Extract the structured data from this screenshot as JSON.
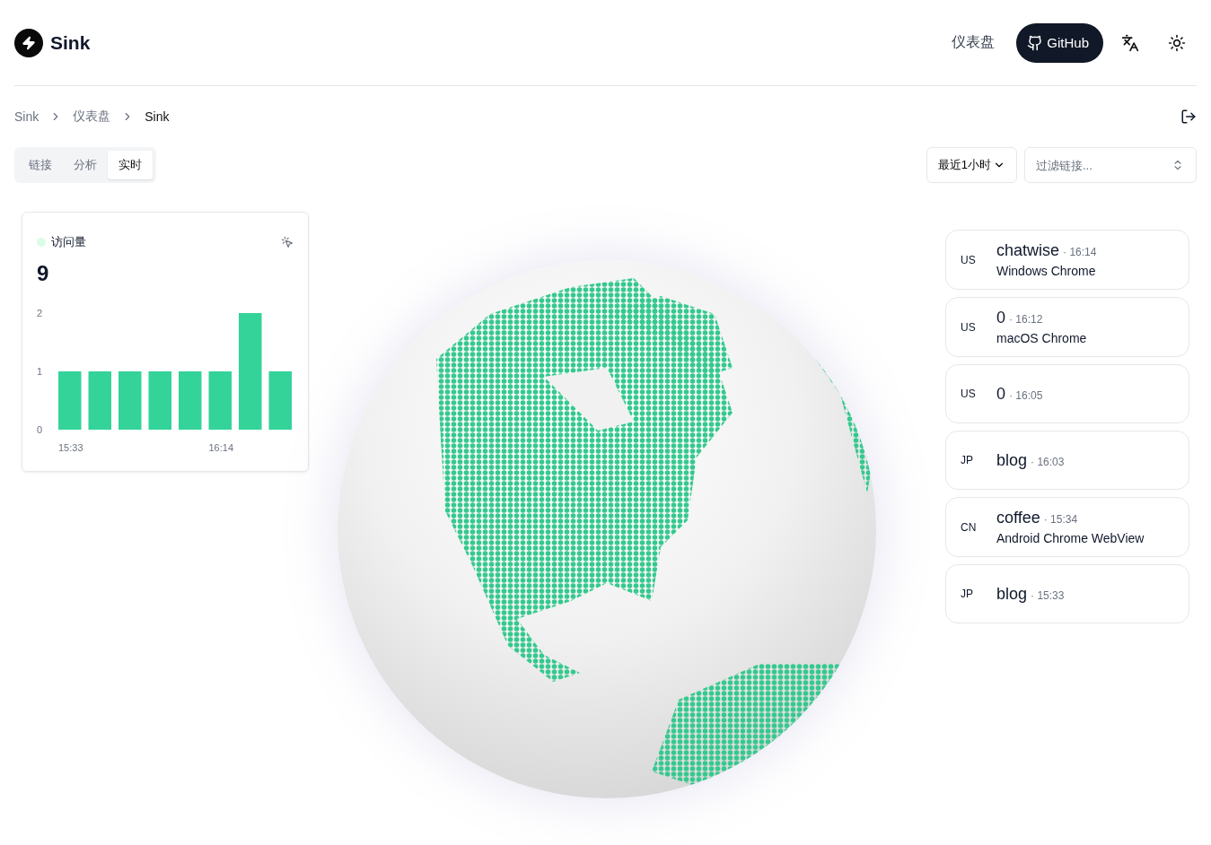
{
  "header": {
    "logo": "Sink",
    "nav_link": "仪表盘",
    "github_button": "GitHub"
  },
  "breadcrumb": [
    "Sink",
    "仪表盘",
    "Sink"
  ],
  "tabs": [
    {
      "label": "链接",
      "selected": false
    },
    {
      "label": "分析",
      "selected": false
    },
    {
      "label": "实时",
      "selected": true
    }
  ],
  "time_range": "最近1小时",
  "filter": {
    "placeholder": "过滤链接..."
  },
  "visits_card": {
    "title": "访问量",
    "total": "9",
    "chart_data": {
      "type": "bar",
      "categories": [
        "15:33",
        null,
        null,
        null,
        null,
        "16:14",
        null,
        null
      ],
      "values": [
        1,
        1,
        1,
        1,
        1,
        1,
        2,
        1
      ],
      "ylim": [
        0,
        2
      ],
      "yticks": [
        0,
        1,
        2
      ]
    }
  },
  "events": [
    {
      "country": "US",
      "name": "chatwise",
      "separator": "·",
      "time": "16:14",
      "device": "Windows Chrome"
    },
    {
      "country": "US",
      "name": "0",
      "separator": "·",
      "time": "16:12",
      "device": "macOS Chrome"
    },
    {
      "country": "US",
      "name": "0",
      "separator": "·",
      "time": "16:05"
    },
    {
      "country": "JP",
      "name": "blog",
      "separator": "·",
      "time": "16:03"
    },
    {
      "country": "CN",
      "name": "coffee",
      "separator": "·",
      "time": "15:34",
      "device": "Android Chrome WebView"
    },
    {
      "country": "JP",
      "name": "blog",
      "separator": "·",
      "time": "15:33"
    }
  ]
}
